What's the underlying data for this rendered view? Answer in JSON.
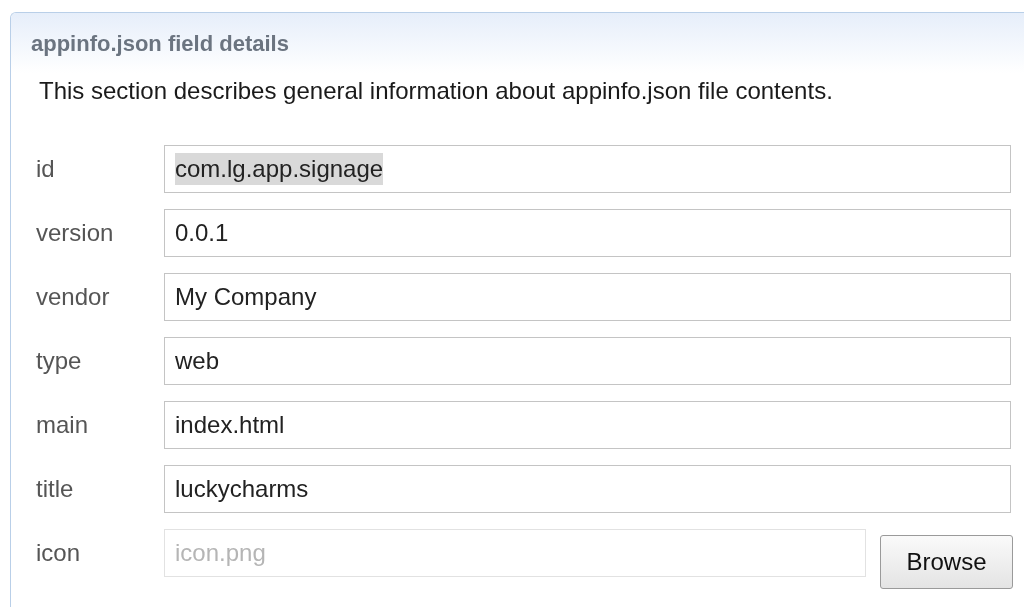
{
  "section": {
    "title": "appinfo.json field details",
    "description": "This section describes general information about appinfo.json file contents."
  },
  "fields": [
    {
      "kind": "text",
      "label": "id",
      "value": "com.lg.app.signage",
      "text_selected": true,
      "disabled": false
    },
    {
      "kind": "text",
      "label": "version",
      "value": "0.0.1",
      "text_selected": false,
      "disabled": false
    },
    {
      "kind": "text",
      "label": "vendor",
      "value": "My Company",
      "text_selected": false,
      "disabled": false
    },
    {
      "kind": "text",
      "label": "type",
      "value": "web",
      "text_selected": false,
      "disabled": false
    },
    {
      "kind": "text",
      "label": "main",
      "value": "index.html",
      "text_selected": false,
      "disabled": false
    },
    {
      "kind": "text",
      "label": "title",
      "value": "luckycharms",
      "text_selected": false,
      "disabled": false
    },
    {
      "kind": "file",
      "label": "icon",
      "value": "icon.png",
      "text_selected": false,
      "disabled": true,
      "button": "Browse"
    }
  ]
}
